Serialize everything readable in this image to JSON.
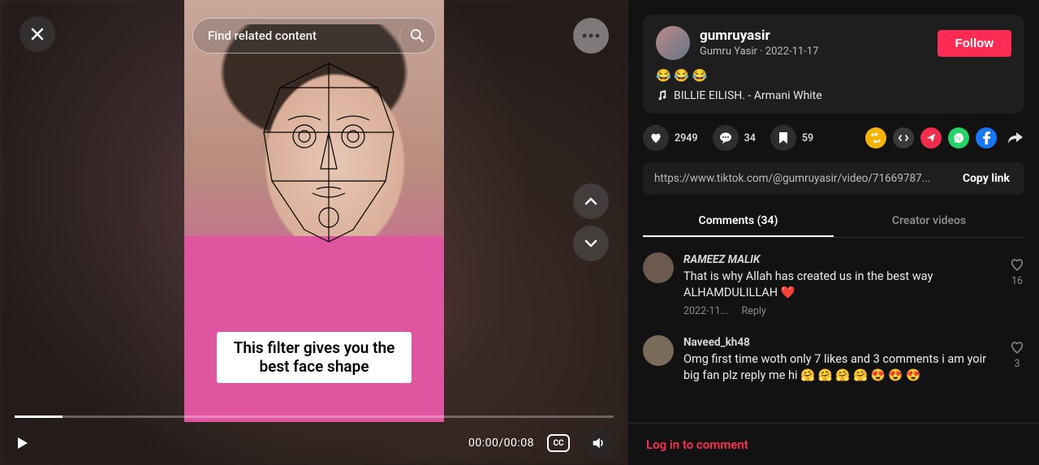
{
  "video": {
    "search_placeholder": "Find related content",
    "caption": "This filter gives you the best face shape",
    "time_current": "00:00",
    "time_total": "00:08",
    "cc_label": "CC"
  },
  "author": {
    "handle": "gumruyasir",
    "display_name": "Gumru Yasir",
    "date": "2022-11-17",
    "follow_label": "Follow",
    "description": "😂 😂 😂",
    "music": "BILLIE EILISH. - Armani White"
  },
  "stats": {
    "likes": "2949",
    "comments": "34",
    "saves": "59"
  },
  "link": {
    "url": "https://www.tiktok.com/@gumruyasir/video/71669787...",
    "copy_label": "Copy link"
  },
  "tabs": {
    "comments_label": "Comments (34)",
    "creator_label": "Creator videos"
  },
  "comments": [
    {
      "name": "RAMEEZ MALIK",
      "text": "That is why Allah has created us in the best way ALHAMDULILLAH ❤️",
      "date": "2022-11...",
      "reply": "Reply",
      "likes": "16"
    },
    {
      "name": "Naveed_kh48",
      "text": "Omg first time woth only 7 likes and 3 comments i am yoir big fan plz reply me hi 🤗 🤗 🤗 🤗 😍 😍 😍",
      "date": "",
      "reply": "",
      "likes": "3"
    }
  ],
  "login_prompt": "Log in to comment"
}
